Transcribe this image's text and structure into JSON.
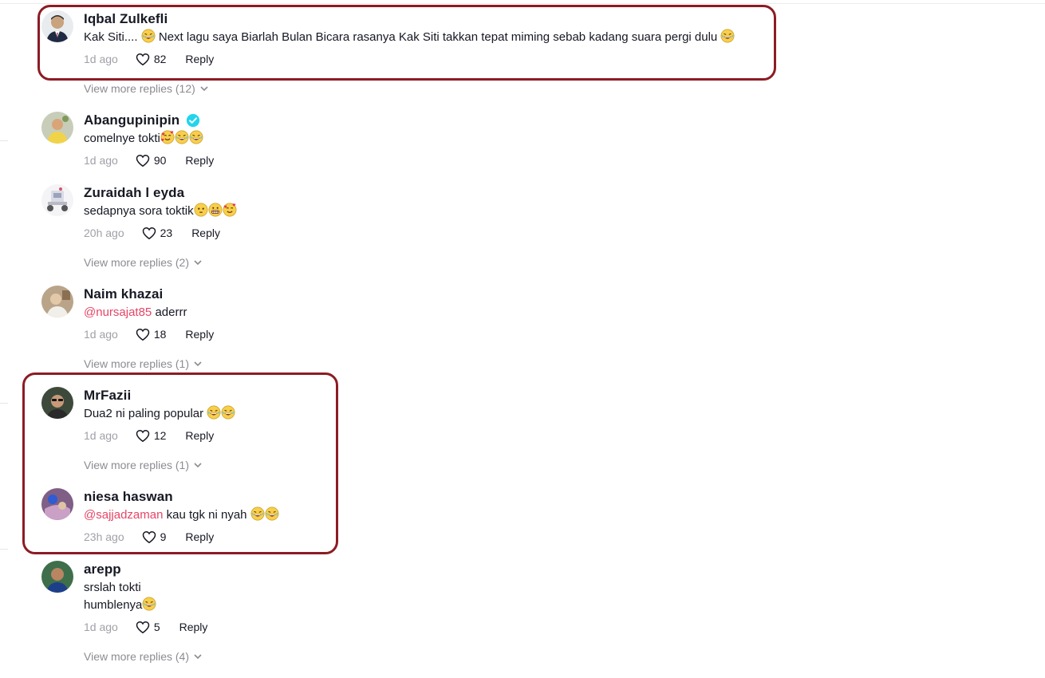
{
  "colors": {
    "highlight": "#8c1c24",
    "mention": "#e64566",
    "verified": "#20d5ec",
    "muted": "#a0a1a8"
  },
  "comments": [
    {
      "username": "Iqbal Zulkefli",
      "verified": false,
      "text_before": "Kak Siti.... ",
      "text_after": " Next lagu saya Biarlah Bulan Bicara rasanya Kak Siti takkan tepat miming sebab kadang suara pergi dulu ",
      "time": "1d ago",
      "likes": "82",
      "reply_label": "Reply",
      "view_more": "View more replies (12)"
    },
    {
      "username": "Abangupinipin",
      "verified": true,
      "text": "comelnye tokti",
      "time": "1d ago",
      "likes": "90",
      "reply_label": "Reply"
    },
    {
      "username": "Zuraidah l eyda",
      "verified": false,
      "text": "sedapnya sora toktik",
      "time": "20h ago",
      "likes": "23",
      "reply_label": "Reply",
      "view_more": "View more replies (2)"
    },
    {
      "username": "Naim khazai",
      "verified": false,
      "mention": "@nursajat85",
      "text": " aderrr",
      "time": "1d ago",
      "likes": "18",
      "reply_label": "Reply",
      "view_more": "View more replies (1)"
    },
    {
      "username": "MrFazii",
      "verified": false,
      "text": "Dua2 ni paling popular ",
      "time": "1d ago",
      "likes": "12",
      "reply_label": "Reply",
      "view_more": "View more replies (1)"
    },
    {
      "username": "niesa haswan",
      "verified": false,
      "mention": "@sajjadzaman",
      "text": " kau tgk ni nyah ",
      "time": "23h ago",
      "likes": "9",
      "reply_label": "Reply"
    },
    {
      "username": "arepp",
      "verified": false,
      "text_line1": "srslah tokti",
      "text_line2": "humblenya",
      "time": "1d ago",
      "likes": "5",
      "reply_label": "Reply",
      "view_more": "View more replies (4)"
    }
  ]
}
